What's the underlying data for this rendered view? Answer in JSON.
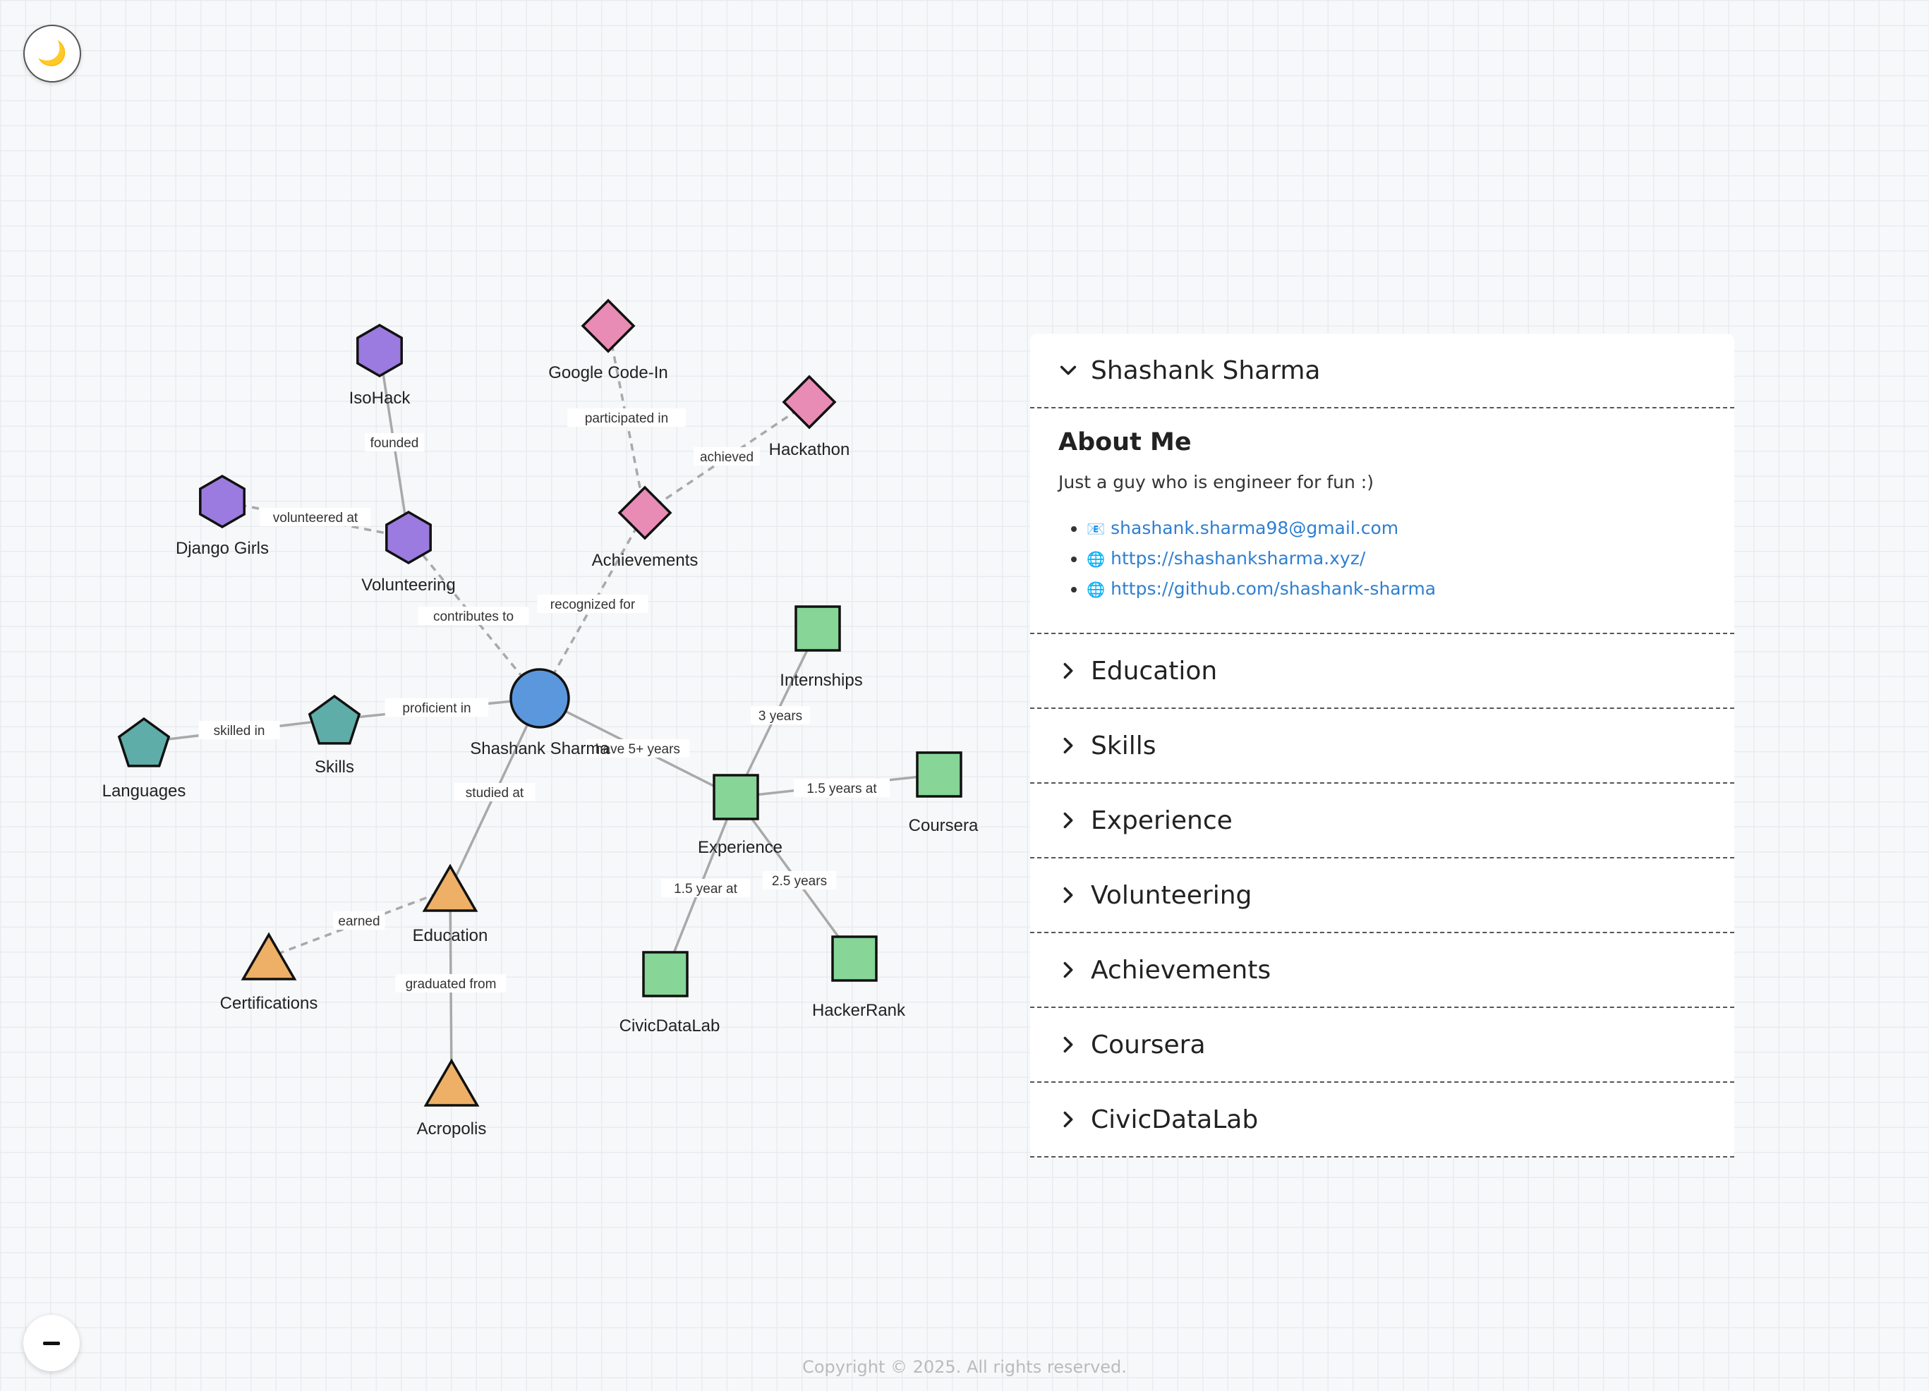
{
  "controls": {
    "theme_icon": "🌙",
    "zoom_out_icon": "minus-icon"
  },
  "graph": {
    "nodes": [
      {
        "id": "center",
        "label": "Shashank Sharma",
        "shape": "circle",
        "color": "#5b97dc"
      },
      {
        "id": "volunteering",
        "label": "Volunteering",
        "shape": "hexagon",
        "color": "#9b7be0"
      },
      {
        "id": "isohack",
        "label": "IsoHack",
        "shape": "hexagon",
        "color": "#9b7be0"
      },
      {
        "id": "django",
        "label": "Django Girls",
        "shape": "hexagon",
        "color": "#9b7be0"
      },
      {
        "id": "achievements",
        "label": "Achievements",
        "shape": "diamond",
        "color": "#e88cb5"
      },
      {
        "id": "gci",
        "label": "Google Code-In",
        "shape": "diamond",
        "color": "#e88cb5"
      },
      {
        "id": "hackathon",
        "label": "Hackathon",
        "shape": "diamond",
        "color": "#e88cb5"
      },
      {
        "id": "skills",
        "label": "Skills",
        "shape": "pentagon",
        "color": "#5fada8"
      },
      {
        "id": "languages",
        "label": "Languages",
        "shape": "pentagon",
        "color": "#5fada8"
      },
      {
        "id": "education",
        "label": "Education",
        "shape": "triangle",
        "color": "#edb066"
      },
      {
        "id": "certs",
        "label": "Certifications",
        "shape": "triangle",
        "color": "#edb066"
      },
      {
        "id": "acropolis",
        "label": "Acropolis",
        "shape": "triangle",
        "color": "#edb066"
      },
      {
        "id": "experience",
        "label": "Experience",
        "shape": "square",
        "color": "#87d597"
      },
      {
        "id": "internships",
        "label": "Internships",
        "shape": "square",
        "color": "#87d597"
      },
      {
        "id": "coursera",
        "label": "Coursera",
        "shape": "square",
        "color": "#87d597"
      },
      {
        "id": "civic",
        "label": "CivicDataLab",
        "shape": "square",
        "color": "#87d597"
      },
      {
        "id": "hackerrank",
        "label": "HackerRank",
        "shape": "square",
        "color": "#87d597"
      }
    ],
    "edges": [
      {
        "from": "center",
        "to": "volunteering",
        "label": "contributes to",
        "style": "dashed"
      },
      {
        "from": "volunteering",
        "to": "isohack",
        "label": "founded",
        "style": "solid"
      },
      {
        "from": "volunteering",
        "to": "django",
        "label": "volunteered at",
        "style": "dashed"
      },
      {
        "from": "center",
        "to": "achievements",
        "label": "recognized for",
        "style": "dashed"
      },
      {
        "from": "achievements",
        "to": "gci",
        "label": "participated in",
        "style": "dashed"
      },
      {
        "from": "achievements",
        "to": "hackathon",
        "label": "achieved",
        "style": "dashed"
      },
      {
        "from": "center",
        "to": "skills",
        "label": "proficient in",
        "style": "solid"
      },
      {
        "from": "skills",
        "to": "languages",
        "label": "skilled in",
        "style": "solid"
      },
      {
        "from": "center",
        "to": "education",
        "label": "studied at",
        "style": "solid"
      },
      {
        "from": "education",
        "to": "certs",
        "label": "earned",
        "style": "dashed"
      },
      {
        "from": "education",
        "to": "acropolis",
        "label": "graduated from",
        "style": "solid"
      },
      {
        "from": "center",
        "to": "experience",
        "label": "have 5+ years",
        "style": "solid"
      },
      {
        "from": "experience",
        "to": "internships",
        "label": "3 years",
        "style": "solid"
      },
      {
        "from": "experience",
        "to": "coursera",
        "label": "1.5 years at",
        "style": "solid"
      },
      {
        "from": "experience",
        "to": "civic",
        "label": "1.5 year at",
        "style": "solid"
      },
      {
        "from": "experience",
        "to": "hackerrank",
        "label": "2.5 years",
        "style": "solid"
      }
    ]
  },
  "panel": {
    "open_section": {
      "title": "Shashank Sharma",
      "heading": "About Me",
      "text": "Just a guy who is engineer for fun :)",
      "links": [
        {
          "icon": "📧",
          "text": "shashank.sharma98@gmail.com"
        },
        {
          "icon": "🌐",
          "text": "https://shashanksharma.xyz/"
        },
        {
          "icon": "🌐",
          "text": "https://github.com/shashank-sharma"
        }
      ]
    },
    "sections": [
      "Education",
      "Skills",
      "Experience",
      "Volunteering",
      "Achievements",
      "Coursera",
      "CivicDataLab"
    ]
  },
  "footer": "Copyright © 2025. All rights reserved."
}
